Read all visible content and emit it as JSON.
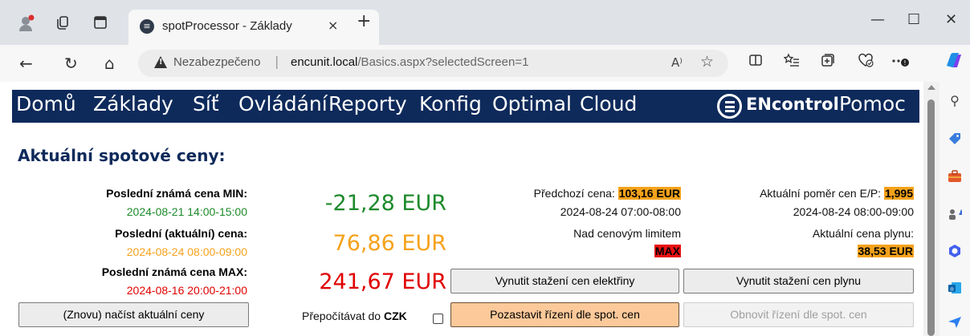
{
  "browser": {
    "tab_title": "spotProcessor - Základy",
    "tab_close": "×",
    "new_tab": "+",
    "minimize": "—",
    "maximize": "☐",
    "close": "✕",
    "security_label": "Nezabezpečeno",
    "url_host": "encunit.local",
    "url_path": "/Basics.aspx?selectedScreen=1",
    "read_aloud": "A⁾",
    "icons": [
      "profile-icon",
      "workspaces-icon",
      "tab-actions-icon",
      "back-icon",
      "refresh-icon",
      "home-icon",
      "split-screen-icon",
      "favorites-icon",
      "collections-icon",
      "browser-essentials-icon",
      "more-icon",
      "copilot-icon"
    ]
  },
  "sidebar_icons": [
    "search-icon",
    "shopping-tag-icon",
    "tools-icon",
    "games-icon",
    "m365-icon",
    "outlook-icon",
    "send-icon"
  ],
  "nav": {
    "items": [
      "Domů",
      "Základy",
      "Síť",
      "Ovládání",
      "Reporty",
      "Konfig",
      "Optimal",
      "Cloud"
    ],
    "logo": "ENcontrol",
    "help": "Pomoc"
  },
  "heading": "Aktuální spotové ceny:",
  "left": {
    "min_label": "Poslední známá cena MIN:",
    "min_time": "2024-08-21 14:00-15:00",
    "current_label": "Poslední (aktuální) cena:",
    "current_time": "2024-08-24 08:00-09:00",
    "max_label": "Poslední známá cena MAX:",
    "max_time": "2024-08-16 20:00-21:00"
  },
  "prices": {
    "min": "-21,28 EUR",
    "current": "76,86 EUR",
    "max": "241,67 EUR"
  },
  "middle": {
    "prev_label": "Předchozí cena:",
    "prev_value": "103,16 EUR",
    "prev_time": "2024-08-24 07:00-08:00",
    "limit_label": "Nad cenovým limitem",
    "limit_value": "MAX"
  },
  "right": {
    "ratio_label": "Aktuální poměr cen E/P:",
    "ratio_value": "1,995",
    "ratio_time": "2024-08-24 08:00-09:00",
    "gas_label": "Aktuální cena plynu:",
    "gas_value": "38,53 EUR"
  },
  "buttons": {
    "reload": "(Znovu) načíst aktuální ceny",
    "convert_prefix": "Přepočítávat do",
    "convert_currency": "CZK",
    "force_electricity": "Vynutit stažení cen elektřiny",
    "force_gas": "Vynutit stažení cen plynu",
    "pause_control": "Pozastavit řízení dle spot. cen",
    "resume_control": "Obnovit řízení dle spot. cen"
  },
  "colors": {
    "nav_bg": "#0e2a5b",
    "heading": "#0e2a5b",
    "green": "#1e8a2c",
    "orange": "#f5a21b",
    "red": "#e00000",
    "highlight_orange": "#f5a21b",
    "highlight_red": "#e81010",
    "pause_button": "#fcc99a"
  }
}
